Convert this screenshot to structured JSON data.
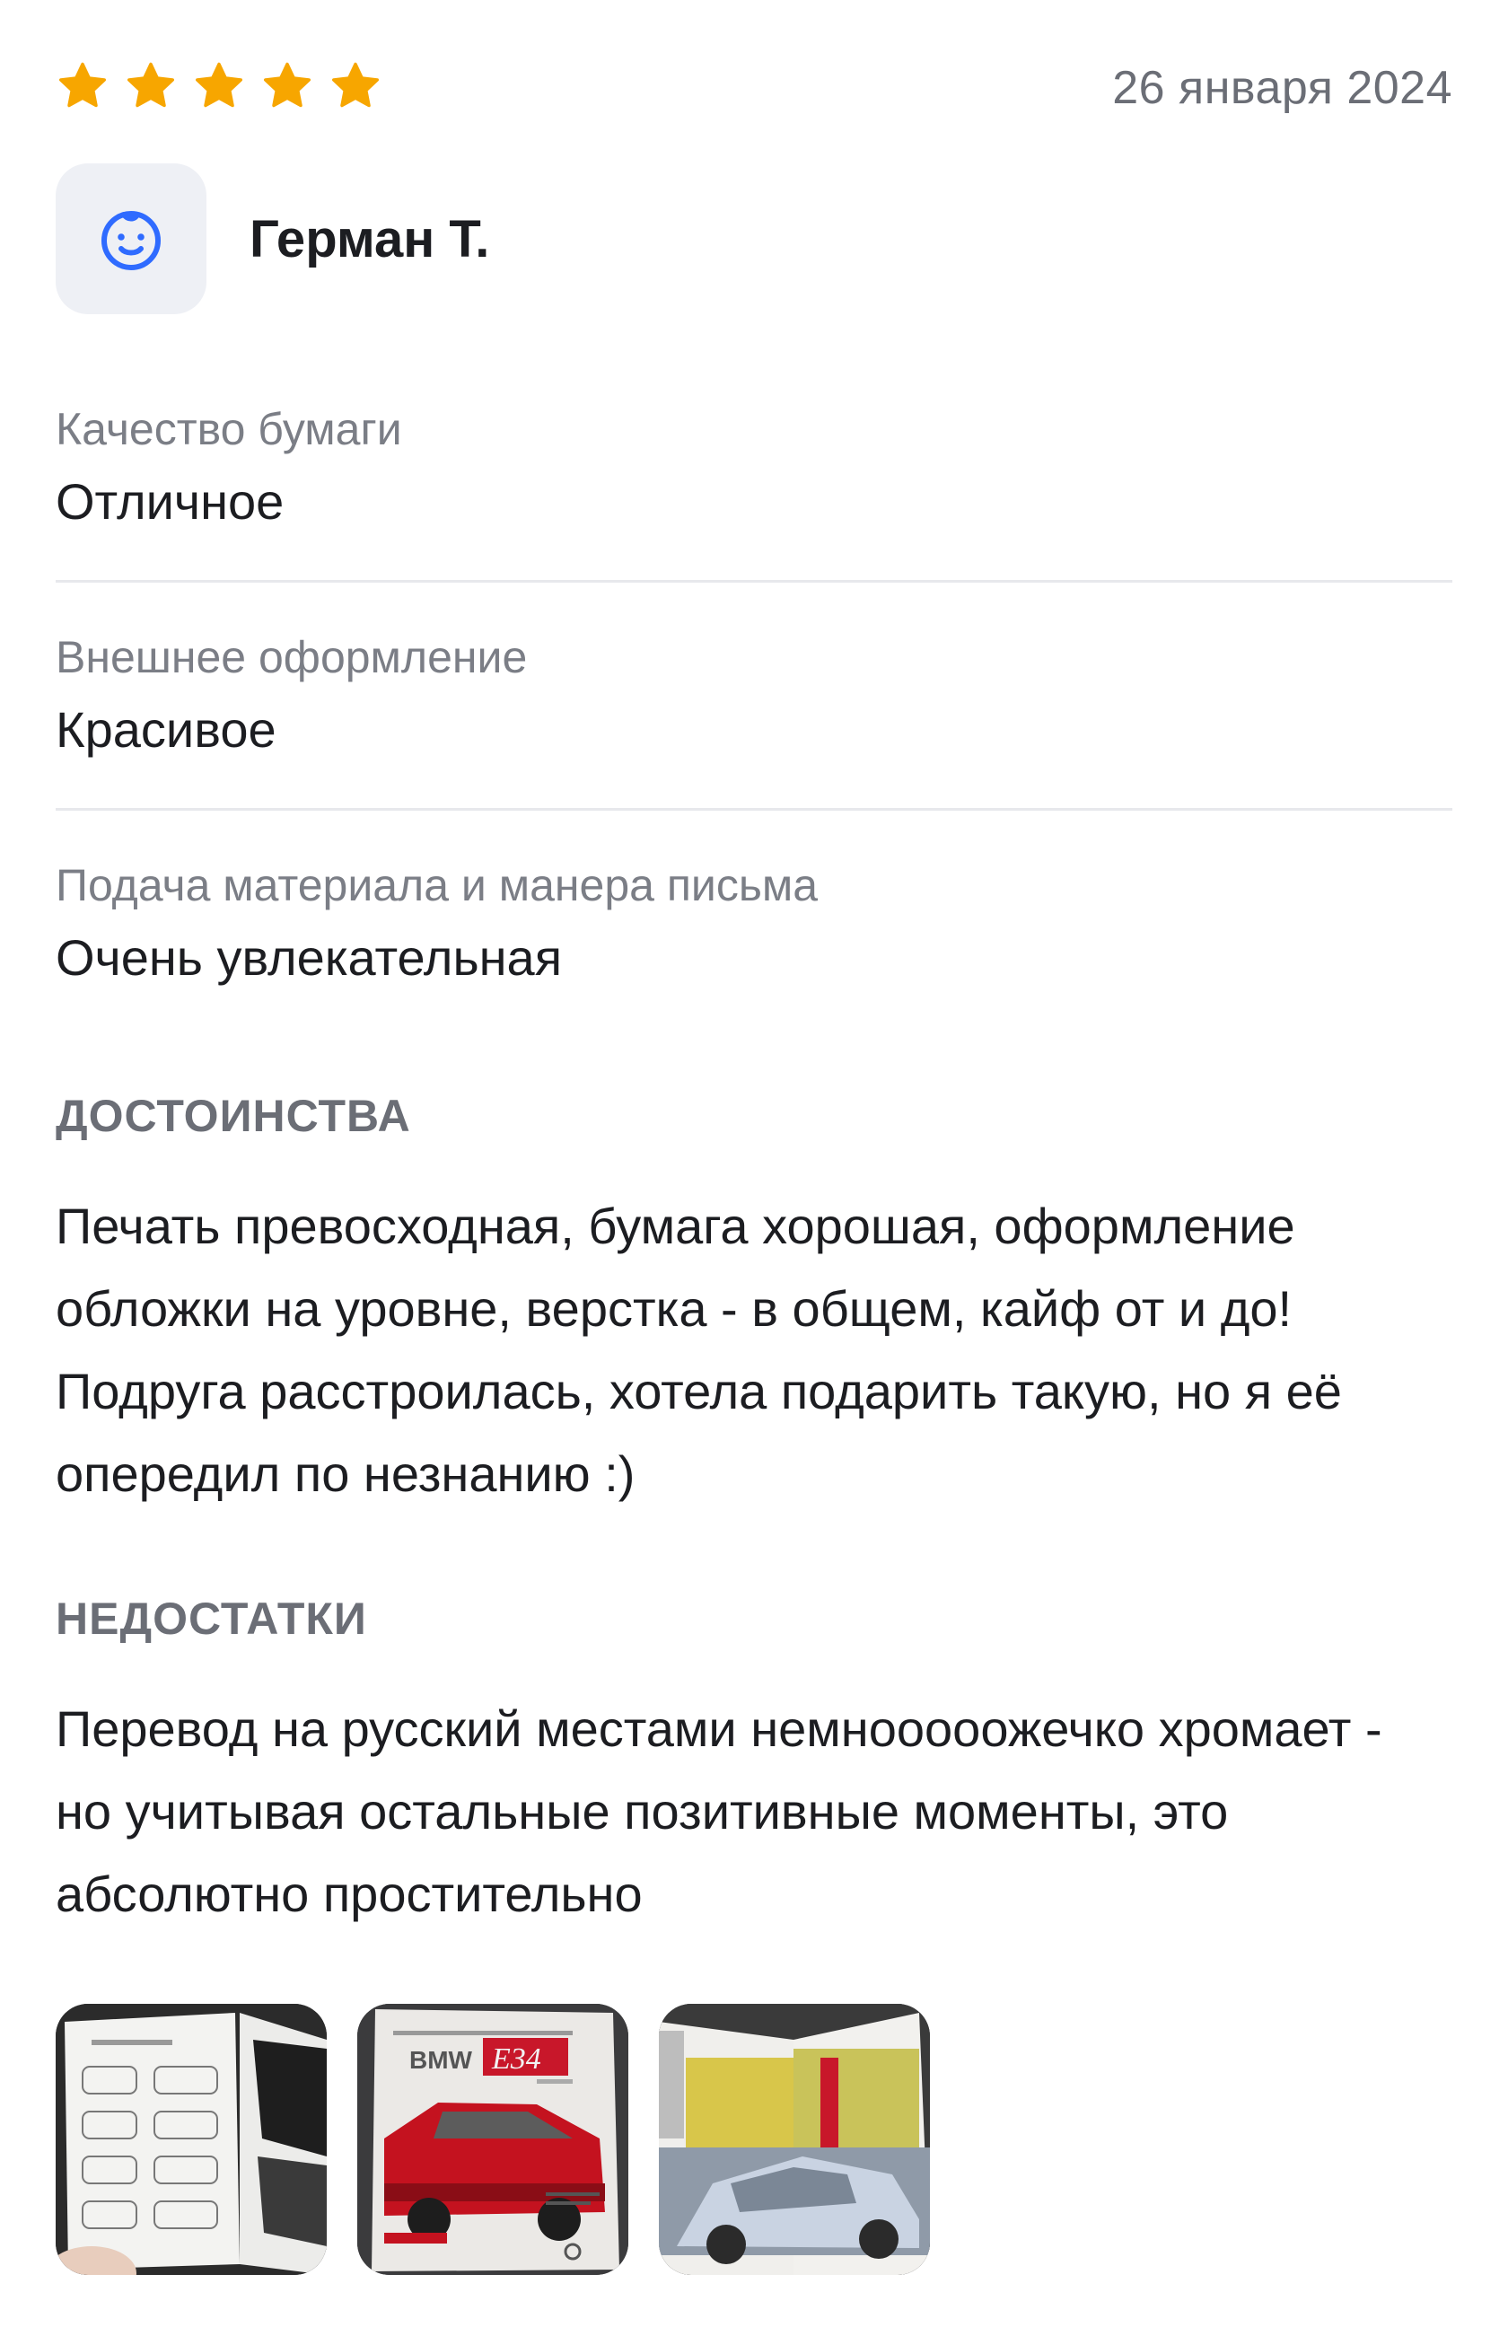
{
  "review": {
    "rating": 5,
    "rating_max": 5,
    "date": "26 января 2024",
    "author": {
      "name": "Герман Т.",
      "avatar_icon": "baby-face-icon"
    },
    "attributes": [
      {
        "label": "Качество бумаги",
        "value": "Отличное"
      },
      {
        "label": "Внешнее оформление",
        "value": "Красивое"
      },
      {
        "label": "Подача материала и манера письма",
        "value": "Очень увлекательная"
      }
    ],
    "pros": {
      "title": "ДОСТОИНСТВА",
      "text": "Печать превосходная, бумага хорошая, оформление обложки на уровне, верстка - в общем, кайф от и до! Подруга расстроилась, хотела подарить такую, но я её опередил по незнанию :)"
    },
    "cons": {
      "title": "НЕДОСТАТКИ",
      "text": "Перевод на русский местами немнооооожечко хромает - но учитывая остальные позитивные моменты, это абсолютно простительно"
    },
    "photos": [
      {
        "name": "photo-car-silhouettes-page"
      },
      {
        "name": "photo-book-cover",
        "cover_brand": "BMW",
        "cover_model": "E34"
      },
      {
        "name": "photo-car-spread-page"
      }
    ]
  },
  "colors": {
    "star": "#f7a600",
    "accent": "#2f6bff",
    "muted": "#7b7e86",
    "divider": "#e7e8ec"
  }
}
